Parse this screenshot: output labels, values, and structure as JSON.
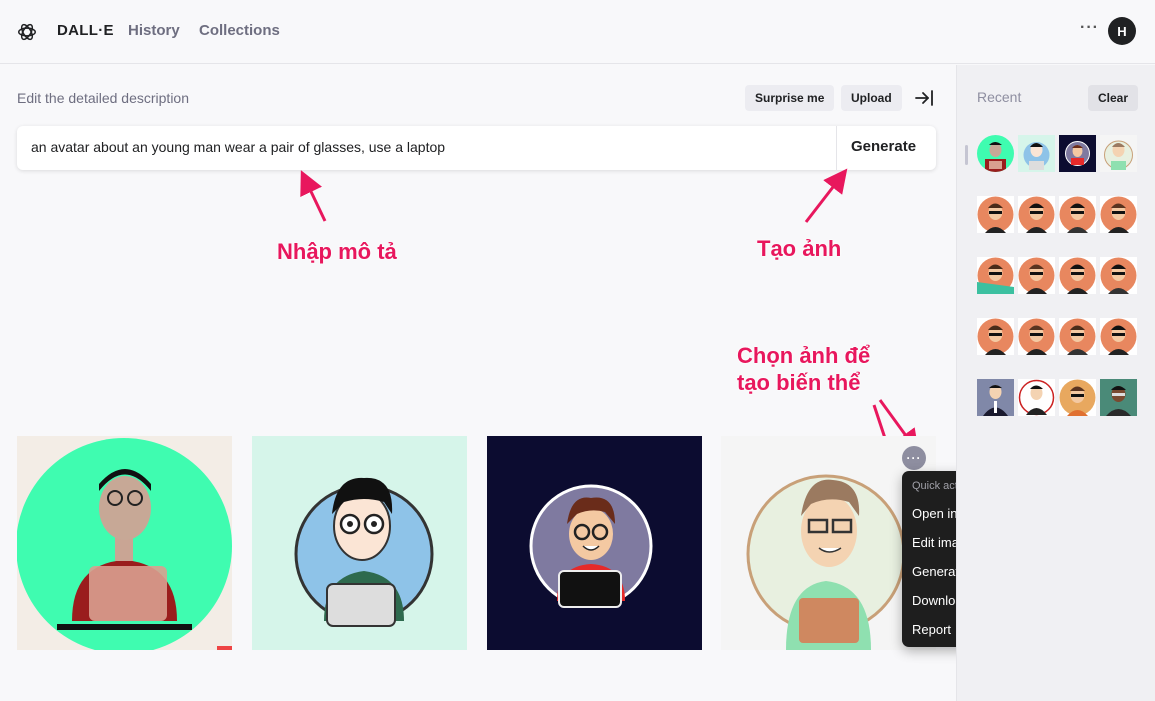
{
  "app": {
    "brand": "DALL·E",
    "nav": [
      "History",
      "Collections"
    ],
    "user_initial": "H"
  },
  "editor": {
    "label": "Edit the detailed description",
    "surprise_label": "Surprise me",
    "upload_label": "Upload",
    "prompt_value": "an avatar about an young man wear a pair of glasses, use a laptop",
    "generate_label": "Generate"
  },
  "annotations": {
    "input_hint": "Nhập mô tả",
    "generate_hint": "Tạo ảnh",
    "variation_hint_line1": "Chọn ảnh để",
    "variation_hint_line2": "tạo biến thể",
    "color": "#e8175d"
  },
  "quick_actions": {
    "heading": "Quick actions",
    "items": [
      "Open in new tab",
      "Edit image",
      "Generate variations",
      "Download",
      "Report"
    ]
  },
  "sidebar": {
    "recent_label": "Recent",
    "clear_label": "Clear"
  },
  "icons": [
    "openai-logo-icon",
    "more-icon",
    "collapse-panel-icon",
    "tile-menu-icon"
  ]
}
